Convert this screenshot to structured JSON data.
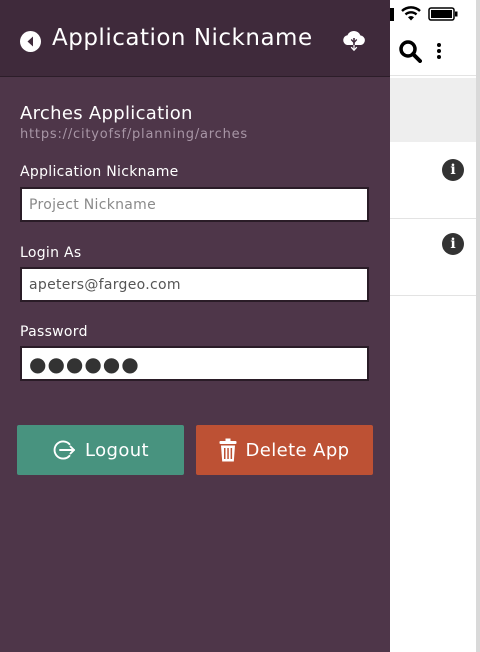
{
  "header": {
    "title": "Application Nickname",
    "back_icon": "back-arrow-circle-icon",
    "sync_icon": "cloud-download-icon"
  },
  "app": {
    "name": "Arches Application",
    "url": "https://cityofsf/planning/arches"
  },
  "form": {
    "nickname_label": "Application Nickname",
    "nickname_placeholder": "Project Nickname",
    "nickname_value": "",
    "login_label": "Login As",
    "login_value": "apeters@fargeo.com",
    "password_label": "Password",
    "password_value": "●●●●●●"
  },
  "buttons": {
    "logout_label": "Logout",
    "logout_icon": "logout-icon",
    "delete_label": "Delete App",
    "delete_icon": "trash-icon"
  },
  "background": {
    "status_icons": [
      "signal-icon",
      "wifi-icon",
      "battery-icon"
    ],
    "toolbar_icons": [
      "search-icon",
      "more-vertical-icon"
    ],
    "row_icon": "info-icon",
    "row_icon_glyph": "i"
  },
  "colors": {
    "drawer_bg": "#4e3649",
    "header_bg": "#3f2a3b",
    "logout_bg": "#48937f",
    "delete_bg": "#bd5134",
    "url_text": "#a896a6"
  }
}
